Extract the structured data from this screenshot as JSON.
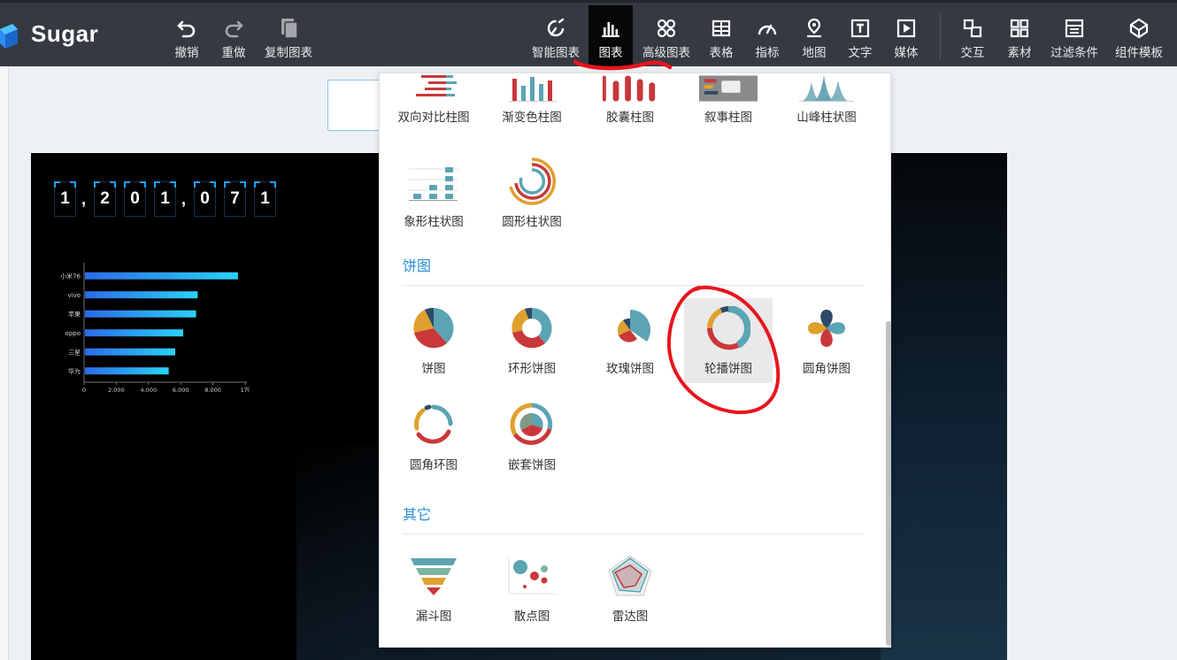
{
  "app": {
    "brand": "Sugar"
  },
  "toolbar_left": [
    {
      "label": "撤销",
      "icon": "undo-icon"
    },
    {
      "label": "重做",
      "icon": "redo-icon"
    },
    {
      "label": "复制图表",
      "icon": "copy-icon"
    }
  ],
  "toolbar_right": [
    {
      "label": "智能图表",
      "icon": "smart-chart-icon"
    },
    {
      "label": "图表",
      "icon": "bar-chart-icon",
      "active": true
    },
    {
      "label": "高级图表",
      "icon": "advanced-chart-icon"
    },
    {
      "label": "表格",
      "icon": "table-icon"
    },
    {
      "label": "指标",
      "icon": "gauge-icon"
    },
    {
      "label": "地图",
      "icon": "map-pin-icon"
    },
    {
      "label": "文字",
      "icon": "text-icon"
    },
    {
      "label": "媒体",
      "icon": "media-icon"
    },
    {
      "label": "交互",
      "icon": "interaction-icon"
    },
    {
      "label": "素材",
      "icon": "assets-icon"
    },
    {
      "label": "过滤条件",
      "icon": "filter-icon"
    },
    {
      "label": "组件模板",
      "icon": "template-icon"
    }
  ],
  "canvas": {
    "counter": [
      "1",
      ",",
      "2",
      "0",
      "1",
      ",",
      "0",
      "7",
      "1"
    ]
  },
  "chart_data": {
    "type": "bar",
    "orientation": "horizontal",
    "categories": [
      "小米76",
      "vivo",
      "苹果",
      "oppo",
      "三星",
      "华为"
    ],
    "values": [
      9500,
      7000,
      6900,
      6100,
      5600,
      5200
    ],
    "xlim": [
      0,
      10000
    ],
    "xticks": [
      "0",
      "2,000",
      "4,000",
      "6,000",
      "8,000",
      "1万"
    ],
    "colors": {
      "bar_start": "#2b6be8",
      "bar_end": "#29d2f5"
    }
  },
  "menu": {
    "bar_row1": [
      "双向对比柱图",
      "渐变色柱图",
      "胶囊柱图",
      "叙事柱图",
      "山峰柱状图"
    ],
    "bar_row2": [
      "象形柱状图",
      "圆形柱状图"
    ],
    "pie_title": "饼图",
    "pie_row1": [
      "饼图",
      "环形饼图",
      "玫瑰饼图",
      "轮播饼图",
      "圆角饼图"
    ],
    "pie_row2": [
      "圆角环图",
      "嵌套饼图"
    ],
    "other_title": "其它",
    "other_row": [
      "漏斗图",
      "散点图",
      "雷达图"
    ],
    "highlighted": "轮播饼图"
  },
  "colors": {
    "accent": "#2a8ed6",
    "topbar": "#353941",
    "annotation": "#e8141e"
  }
}
